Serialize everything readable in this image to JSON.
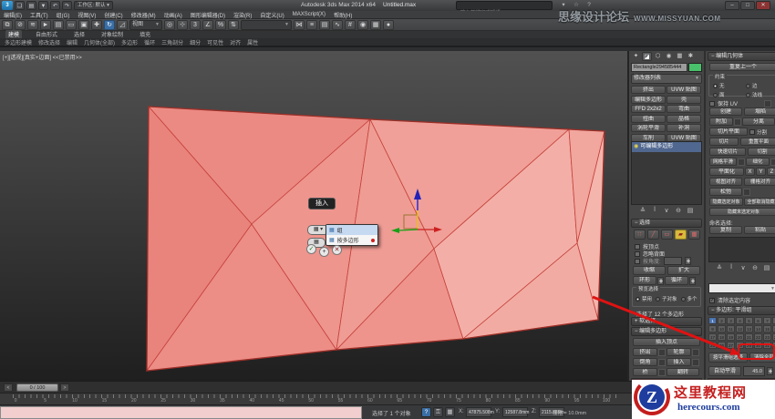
{
  "titlebar": {
    "logo": "3",
    "workspace": "工作区: 默认",
    "title": "Autodesk 3ds Max 2014 x64",
    "filename": "Untitled.max",
    "search_placeholder": "输入关键字或短语",
    "min": "–",
    "max": "□",
    "close": "✕",
    "quick_icons": [
      {
        "name": "new-file-icon",
        "glyph": "❏"
      },
      {
        "name": "open-file-icon",
        "glyph": "▤"
      },
      {
        "name": "save-icon",
        "glyph": "▼"
      },
      {
        "name": "undo-icon",
        "glyph": "↶"
      },
      {
        "name": "redo-icon",
        "glyph": "↷"
      }
    ],
    "infocenter_icons": [
      {
        "name": "search-go-icon",
        "glyph": "▾"
      },
      {
        "name": "favorites-star-icon",
        "glyph": "☆"
      },
      {
        "name": "help-icon",
        "glyph": "?"
      }
    ]
  },
  "watermark_top": {
    "site": "思缘设计论坛",
    "url": "WWW.MISSYUAN.COM"
  },
  "menu": {
    "items": [
      "编辑(E)",
      "工具(T)",
      "组(G)",
      "视图(V)",
      "创建(C)",
      "修改器(M)",
      "动画(A)",
      "图形编辑器(D)",
      "渲染(R)",
      "自定义(U)",
      "MAXScript(X)",
      "帮助(H)"
    ]
  },
  "toolbar": {
    "icons_a": [
      {
        "name": "select-link-icon",
        "glyph": "⧉"
      },
      {
        "name": "unlink-icon",
        "glyph": "⊘"
      },
      {
        "name": "bind-spacewarp-icon",
        "glyph": "≋"
      },
      {
        "name": "select-object-icon",
        "glyph": "►"
      },
      {
        "name": "select-by-name-icon",
        "glyph": "▤"
      },
      {
        "name": "rect-region-icon",
        "glyph": "▭"
      },
      {
        "name": "window-crossing-icon",
        "glyph": "▣"
      },
      {
        "name": "select-move-icon",
        "glyph": "✚"
      },
      {
        "name": "select-rotate-icon",
        "glyph": "↻"
      },
      {
        "name": "select-scale-icon",
        "glyph": "◿"
      }
    ],
    "ref_coord": "视图",
    "icons_b": [
      {
        "name": "use-pivot-icon",
        "glyph": "◎"
      },
      {
        "name": "select-manipulate-icon",
        "glyph": "⊹"
      },
      {
        "name": "snap-toggle-icon",
        "glyph": "3"
      },
      {
        "name": "angle-snap-icon",
        "glyph": "∠"
      },
      {
        "name": "percent-snap-icon",
        "glyph": "%"
      },
      {
        "name": "spinner-snap-icon",
        "glyph": "⇅"
      }
    ],
    "named_sel": "",
    "icons_c": [
      {
        "name": "mirror-icon",
        "glyph": "⋈"
      },
      {
        "name": "align-icon",
        "glyph": "≡"
      },
      {
        "name": "layer-manager-icon",
        "glyph": "▤"
      },
      {
        "name": "curve-editor-icon",
        "glyph": "∿"
      },
      {
        "name": "schematic-view-icon",
        "glyph": "#"
      },
      {
        "name": "material-editor-icon",
        "glyph": "◉"
      },
      {
        "name": "render-setup-icon",
        "glyph": "▦"
      },
      {
        "name": "render-icon",
        "glyph": "●"
      }
    ]
  },
  "ribbon": {
    "tabs": [
      "建模",
      "自由形式",
      "选择",
      "对象绘制",
      "填充"
    ],
    "panels": [
      "多边形建模",
      "修改选择",
      "编辑",
      "几何体(全部)",
      "多边形",
      "循环",
      "三角剖分",
      "细分",
      "可见性",
      "对齐",
      "属性"
    ]
  },
  "viewport": {
    "label": "[+][透视][真实+边面] <<已禁用>>"
  },
  "caddy": {
    "tooltip": "插入",
    "group_label": "组",
    "by_polygon_label": "按多边形",
    "ok": "✓",
    "apply": "+",
    "cancel": "✕"
  },
  "panel": {
    "tabs": [
      {
        "name": "create-tab",
        "glyph": "✦"
      },
      {
        "name": "modify-tab",
        "glyph": "◪"
      },
      {
        "name": "hierarchy-tab",
        "glyph": "⬡"
      },
      {
        "name": "motion-tab",
        "glyph": "◉"
      },
      {
        "name": "display-tab",
        "glyph": "▦"
      },
      {
        "name": "utilities-tab",
        "glyph": "✱"
      }
    ],
    "object_name": "Rectangle294585444",
    "modifier_list": "修改器列表",
    "modifier_buttons": [
      "挤出",
      "UVW 贴图",
      "编辑多边形",
      "壳",
      "FFD 2x2x2",
      "弯曲",
      "扭曲",
      "晶格",
      "涡轮平滑",
      "补洞",
      "车削",
      "UVW 贴图"
    ],
    "stack_item": "可编辑多边形",
    "stack_icons": [
      {
        "name": "pin-stack-icon",
        "glyph": "≙"
      },
      {
        "name": "show-end-result-icon",
        "glyph": "ǀ"
      },
      {
        "name": "make-unique-icon",
        "glyph": "∨"
      },
      {
        "name": "remove-modifier-icon",
        "glyph": "⊖"
      },
      {
        "name": "configure-sets-icon",
        "glyph": "▤"
      }
    ],
    "selection": {
      "title": "选择",
      "subobj_icons": [
        {
          "name": "vertex-icon",
          "glyph": "∷"
        },
        {
          "name": "edge-icon",
          "glyph": "╱"
        },
        {
          "name": "border-icon",
          "glyph": "▭"
        },
        {
          "name": "polygon-icon",
          "glyph": "▰"
        },
        {
          "name": "element-icon",
          "glyph": "▦"
        }
      ],
      "by_vertex": "按顶点",
      "ignore_backfacing": "忽略背面",
      "by_angle": "按角度:",
      "shrink": "收缩",
      "grow": "扩大",
      "ring": "环形",
      "loop": "循环",
      "preview_label": "预览选择",
      "preview_options": [
        "禁用",
        "子对象",
        "多个"
      ],
      "status": "选择了 12 个多边形"
    },
    "soft_selection": "软选择",
    "edit_polygons": {
      "title": "编辑多边形",
      "insert_vertex": "插入顶点",
      "extrude": "挤出",
      "outline": "轮廓",
      "bevel": "倒角",
      "inset": "插入",
      "bridge": "桥",
      "flip": "翻转"
    },
    "edit_geometry": {
      "title": "编辑几何体",
      "repeat_last": "重复上一个",
      "constraints": "约束",
      "constraint_options": [
        "无",
        "边",
        "面",
        "法线"
      ],
      "preserve_uv": "保持 UV",
      "create": "创建",
      "collapse": "塌陷",
      "attach": "附加",
      "detach": "分离",
      "slice_plane": "切片平面",
      "split": "分割",
      "slice": "切片",
      "reset_plane": "重置平面",
      "quickslice": "快速切片",
      "cut": "切割",
      "msmooth": "网格平滑",
      "tessellate": "细化",
      "make_planar": "平面化",
      "x": "X",
      "y": "Y",
      "z": "Z",
      "view_align": "视图对齐",
      "grid_align": "栅格对齐",
      "relax": "松弛",
      "hide_selected": "隐藏选定对象",
      "unhide_all": "全部取消隐藏",
      "hide_unselected": "隐藏未选定对象",
      "named_selections": "命名选择:",
      "copy": "复制",
      "paste": "粘贴",
      "clear_contents": "清除选定内容"
    },
    "smoothing": {
      "title": "多边形: 平滑组",
      "numbers": [
        "1",
        "2",
        "3",
        "4",
        "5",
        "6",
        "7",
        "8",
        "9",
        "10",
        "11",
        "12",
        "13",
        "14",
        "15",
        "16",
        "17",
        "18",
        "19",
        "20",
        "21",
        "22",
        "23",
        "24",
        "25",
        "26",
        "27",
        "28",
        "29",
        "30",
        "31",
        "32"
      ],
      "select_by_sg": "按平滑组选择",
      "clear_all": "清除全部",
      "auto_smooth": "自动平滑",
      "angle": "45.0"
    }
  },
  "timeline": {
    "frame": "0 / 100",
    "prev": "<",
    "next": ">",
    "ticks": [
      "0",
      "5",
      "10",
      "15",
      "20",
      "25",
      "30",
      "35",
      "40",
      "45",
      "50",
      "55",
      "60",
      "65",
      "70",
      "75",
      "80",
      "85",
      "90",
      "95",
      "100"
    ]
  },
  "statusbar": {
    "selection_status": "选择了 1 个对象",
    "help_icon": "?",
    "lock_icon": "🔒",
    "xyz_icon": "▦",
    "x_label": "X:",
    "y_label": "Y:",
    "z_label": "Z:",
    "x": "47875.508m",
    "y": "12587.8mm",
    "z": "2115.889m",
    "grid": "栅格 = 10.0mm"
  },
  "watermark_bottom": {
    "letter": "Z",
    "site": "这里教程网",
    "url": "herecours.com"
  },
  "colors": {
    "mesh_fill": "#ec8b84",
    "mesh_edge": "#c4413a",
    "annotation_red": "#e01212",
    "sg_selected": "#4a72b0"
  }
}
